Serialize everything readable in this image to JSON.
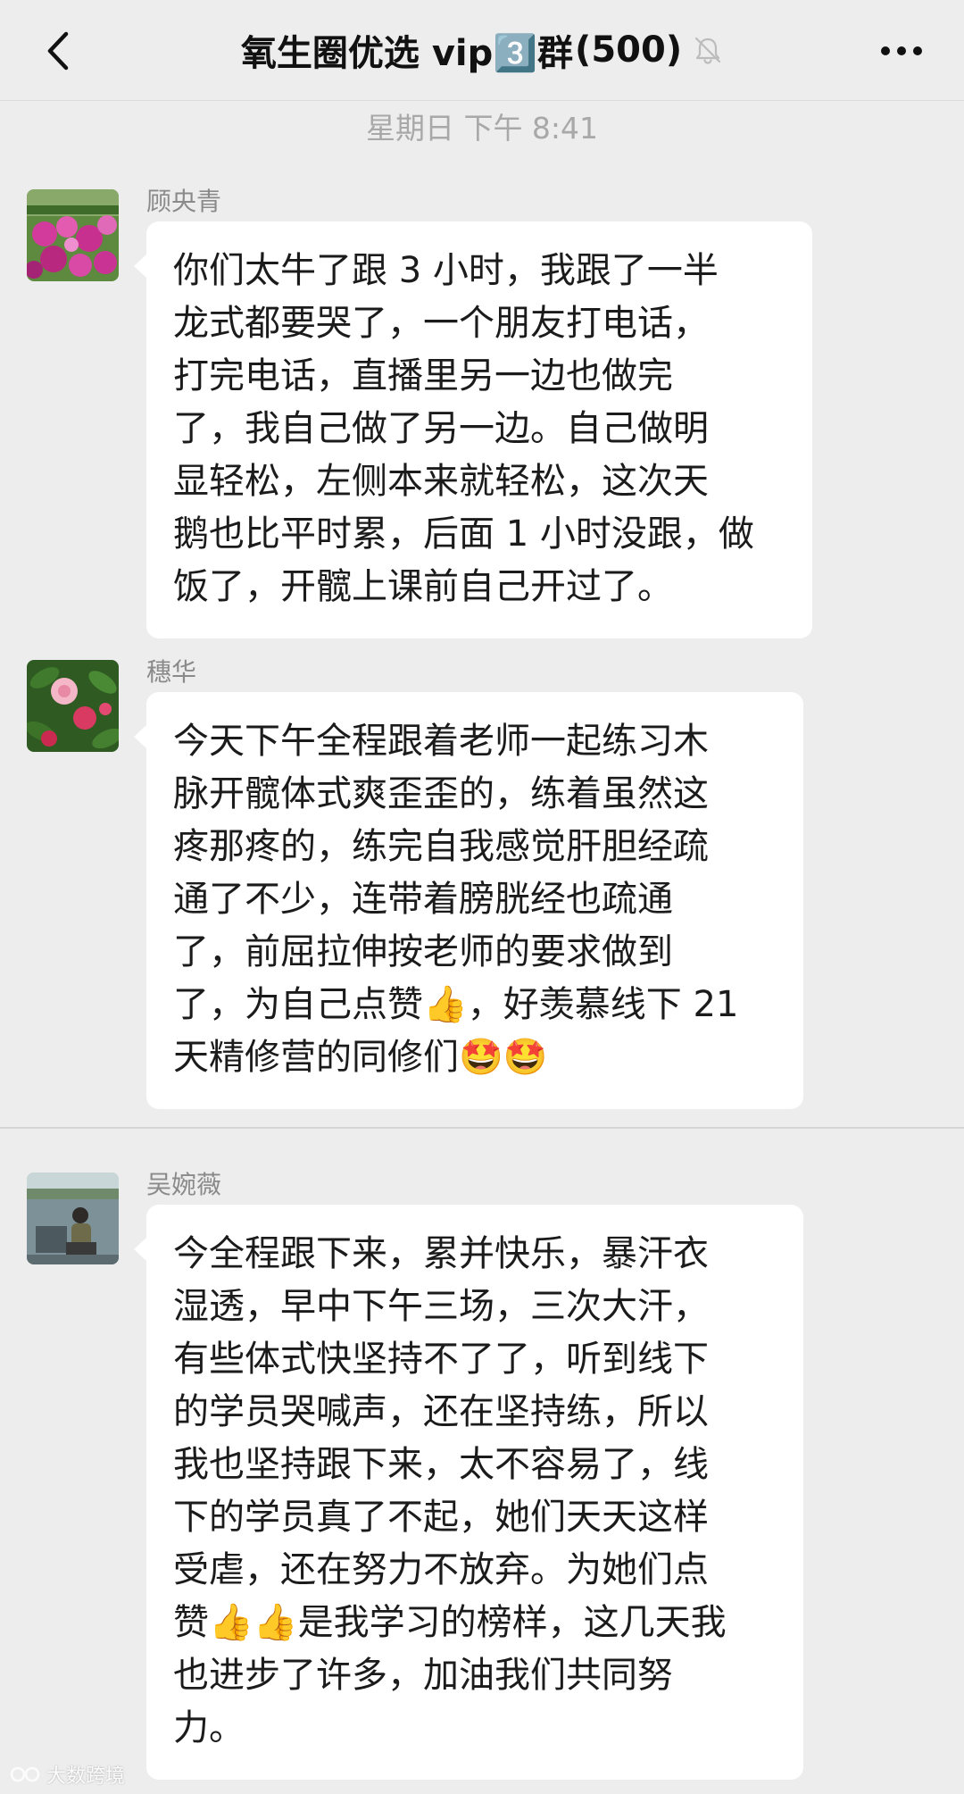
{
  "nav": {
    "title": "氧生圈优选 vip3️⃣群",
    "member_count": "(500)",
    "back_icon": "chevron-left-icon",
    "mute_icon": "bell-off-icon",
    "more_icon": "more-dots-icon"
  },
  "timestamp": "星期日 下午 8:41",
  "messages": [
    {
      "sender": "顾央青",
      "lines": [
        "你们太牛了跟 3 小时，我跟了一半",
        "龙式都要哭了，一个朋友打电话，",
        "打完电话，直播里另一边也做完",
        "了，我自己做了另一边。自己做明",
        "显轻松，左侧本来就轻松，这次天",
        "鹅也比平时累，后面 1 小时没跟，做",
        "饭了，开髋上课前自己开过了。"
      ]
    },
    {
      "sender": "穗华",
      "lines": [
        "今天下午全程跟着老师一起练习木",
        "脉开髋体式爽歪歪的，练着虽然这",
        "疼那疼的，练完自我感觉肝胆经疏",
        "通了不少，连带着膀胱经也疏通",
        "了，前屈拉伸按老师的要求做到",
        "了，为自己点赞👍，好羡慕线下 21",
        "天精修营的同修们🤩🤩"
      ]
    },
    {
      "sender": "吴婉薇",
      "lines": [
        "今全程跟下来，累并快乐，暴汗衣",
        "湿透，早中下午三场，三次大汗，",
        "有些体式快坚持不了了，听到线下",
        "的学员哭喊声，还在坚持练，所以",
        "我也坚持跟下来，太不容易了，线",
        "下的学员真了不起，她们天天这样",
        "受虐，还在努力不放弃。为她们点",
        "赞👍👍是我学习的榜样，这几天我",
        "也进步了许多，加油我们共同努",
        "力。"
      ]
    }
  ],
  "watermark": "大数跨境",
  "colors": {
    "background": "#ededed",
    "bubble": "#ffffff",
    "sender_text": "#8a8a8a",
    "timestamp_text": "#a8a8a8"
  }
}
